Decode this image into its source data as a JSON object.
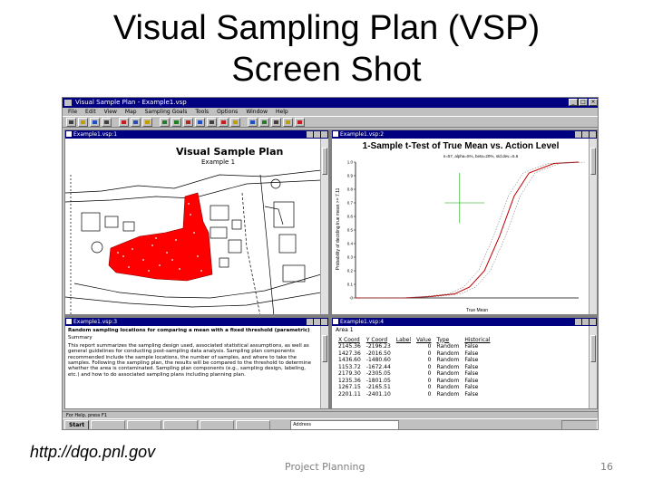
{
  "slide": {
    "title_line1": "Visual Sampling Plan (VSP)",
    "title_line2": "Screen Shot",
    "footer_url": "http://dqo.pnl.gov",
    "footer_center": "Project Planning",
    "page_number": "16"
  },
  "app": {
    "title": "Visual Sample Plan - Example1.vsp",
    "menu": [
      "File",
      "Edit",
      "View",
      "Map",
      "Sampling Goals",
      "Tools",
      "Options",
      "Window",
      "Help"
    ],
    "status_text": "For Help, press F1"
  },
  "windows": {
    "map": {
      "title": "Example1.vsp:1",
      "heading": "Visual Sample Plan",
      "subheading": "Example 1"
    },
    "graph": {
      "title": "Example1.vsp:2"
    },
    "report": {
      "title": "Example1.vsp:3"
    },
    "table": {
      "title": "Example1.vsp:4"
    }
  },
  "chart_data": {
    "type": "line",
    "title": "1-Sample t-Test of True Mean vs. Action Level",
    "subtitle": "n=57, alpha=5%, beta=20%, std.dev.=5.6",
    "ylabel": "Probability of deciding true mean >= 7.11",
    "xlabel": "True Mean",
    "ylim": [
      0,
      1
    ],
    "yticks": [
      "1.0",
      "0.9",
      "0.8",
      "0.7",
      "0.6",
      "0.5",
      "0.4",
      "0.3",
      "0.2",
      "0.1",
      "0"
    ],
    "grid": false,
    "legend": "none",
    "series": [
      {
        "color": "#c00000",
        "x": [
          3.0,
          4.0,
          4.5,
          5.0,
          5.3,
          5.6,
          5.9,
          6.2,
          6.5,
          7.0,
          7.5
        ],
        "y": [
          0.0,
          0.0,
          0.01,
          0.03,
          0.08,
          0.2,
          0.45,
          0.75,
          0.92,
          0.99,
          1.0
        ]
      }
    ]
  },
  "report": {
    "heading": "Random sampling locations for comparing a mean with a fixed threshold (parametric)",
    "summary_label": "Summary",
    "body": "This report summarizes the sampling design used, associated statistical assumptions, as well as general guidelines for conducting post-sampling data analysis. Sampling plan components recommended include the sample locations, the number of samples, and where to take the samples. Following the sampling plan, the results will be compared to the threshold to determine whether the area is contaminated. Sampling plan components (e.g., sampling design, labeling, etc.) and how to do associated sampling plans including planning plan."
  },
  "table": {
    "caption": "Area 1",
    "columns": [
      "X Coord",
      "Y Coord",
      "Label",
      "Value",
      "Type",
      "Historical"
    ],
    "rows": [
      [
        "2145.36",
        "-2196.23",
        "",
        "0",
        "Random",
        "False"
      ],
      [
        "1427.36",
        "-2016.50",
        "",
        "0",
        "Random",
        "False"
      ],
      [
        "1436.60",
        "-1480.60",
        "",
        "0",
        "Random",
        "False"
      ],
      [
        "1153.72",
        "-1672.44",
        "",
        "0",
        "Random",
        "False"
      ],
      [
        "2179.30",
        "-2305.05",
        "",
        "0",
        "Random",
        "False"
      ],
      [
        "1235.36",
        "-1801.05",
        "",
        "0",
        "Random",
        "False"
      ],
      [
        "1267.15",
        "-2165.51",
        "",
        "0",
        "Random",
        "False"
      ],
      [
        "2201.11",
        "-2401.10",
        "",
        "0",
        "Random",
        "False"
      ]
    ]
  },
  "taskbar": {
    "start_label": "Start",
    "address_label": "Address"
  },
  "colors": {
    "sample_area": "#ff0000",
    "title_bar": "#000080",
    "curve": "#c00000",
    "footer_gray": "#7f7f7f"
  }
}
